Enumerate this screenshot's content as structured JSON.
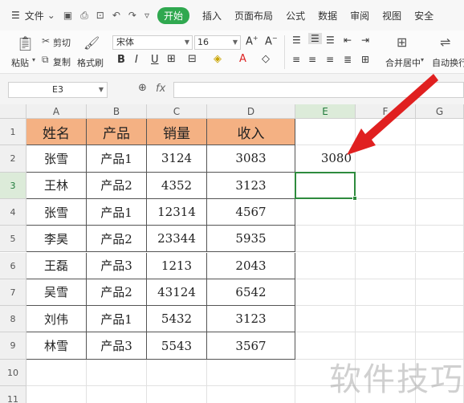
{
  "menu": {
    "file": "文件",
    "active_tab": "开始",
    "tabs": [
      "插入",
      "页面布局",
      "公式",
      "数据",
      "审阅",
      "视图",
      "安全"
    ]
  },
  "ribbon": {
    "paste": "粘贴",
    "cut": "剪切",
    "copy": "复制",
    "format_painter": "格式刷",
    "font_name": "宋体",
    "font_size": "16",
    "merge_center": "合并居中",
    "wrap_text": "自动换行"
  },
  "formula_bar": {
    "cell_ref": "E3",
    "fx": "fx",
    "content": ""
  },
  "sheet": {
    "columns": [
      "A",
      "B",
      "C",
      "D",
      "E",
      "F",
      "G"
    ],
    "rows": [
      "1",
      "2",
      "3",
      "4",
      "5",
      "6",
      "7",
      "8",
      "9",
      "10",
      "11"
    ],
    "header": [
      "姓名",
      "产品",
      "销量",
      "收入"
    ],
    "data": [
      [
        "张雪",
        "产品1",
        "3124",
        "3083"
      ],
      [
        "王林",
        "产品2",
        "4352",
        "3123"
      ],
      [
        "张雪",
        "产品1",
        "12314",
        "4567"
      ],
      [
        "李昊",
        "产品2",
        "23344",
        "5935"
      ],
      [
        "王磊",
        "产品3",
        "1213",
        "2043"
      ],
      [
        "吴雪",
        "产品2",
        "43124",
        "6542"
      ],
      [
        "刘伟",
        "产品1",
        "5432",
        "3123"
      ],
      [
        "林雪",
        "产品3",
        "5543",
        "3567"
      ]
    ],
    "e2_value": "3080",
    "selected_cell": "E3"
  },
  "watermark": "软件技巧",
  "colors": {
    "header_fill": "#f4b183",
    "selection": "#2e8b3e",
    "arrow": "#e02020",
    "active_tab": "#2fa84f"
  }
}
